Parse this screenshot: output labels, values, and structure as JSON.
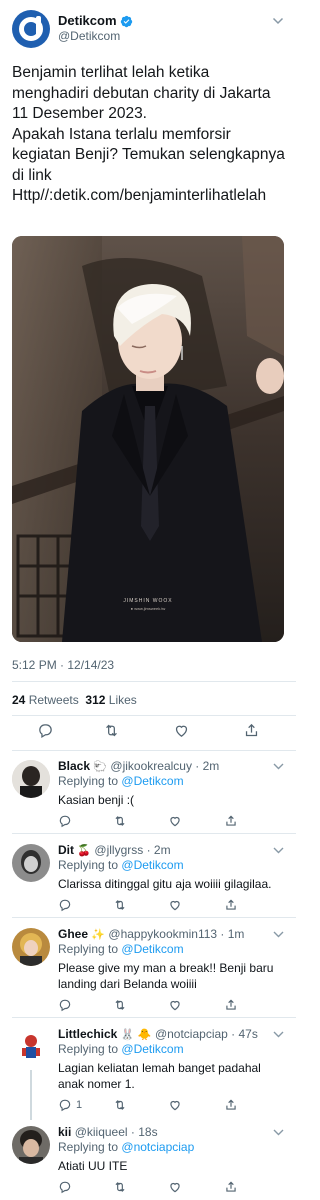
{
  "main": {
    "author_name": "Detikcom",
    "author_handle": "@Detikcom",
    "text": "Benjamin terlihat lelah ketika menghadiri debutan charity di Jakarta 11 Desember 2023.\nApakah Istana terlalu memforsir kegiatan Benji? Temukan selengkapnya di link Http//:detik.com/benjaminterlihatlelah",
    "photo_caption": "JIMSHIN WOOX",
    "photo_caption2": "● www.jimsweek.tw",
    "timestamp": "5:12 PM · 12/14/23",
    "retweets": "24",
    "retweets_label": "Retweets",
    "likes": "312",
    "likes_label": "Likes"
  },
  "replies": [
    {
      "name": "Black",
      "name_emoji": "🐑",
      "handle": "@jikookrealcuy · 2m",
      "replying_label": "Replying to",
      "replying_to": "@Detikcom",
      "text": "Kasian benji :(",
      "reply_count": ""
    },
    {
      "name": "Dit",
      "name_emoji": "🍒",
      "handle": "@jllygrss · 2m",
      "replying_label": "Replying to",
      "replying_to": "@Detikcom",
      "text": "Clarissa ditinggal gitu aja woiiii gilagilaa.",
      "reply_count": ""
    },
    {
      "name": "Ghee",
      "name_emoji": "✨",
      "handle": "@happykookmin113 · 1m",
      "replying_label": "Replying to",
      "replying_to": "@Detikcom",
      "text": "Please give my man a break!! Benji baru landing dari Belanda woiiii",
      "reply_count": ""
    },
    {
      "name": "Littlechick",
      "name_emoji": "🐰 🐥",
      "handle": "@notciapciap · 47s",
      "replying_label": "Replying to",
      "replying_to": "@Detikcom",
      "text": "Lagian keliatan lemah banget padahal anak nomer 1.",
      "reply_count": "1"
    },
    {
      "name": "kii",
      "name_emoji": "",
      "handle": "@kiiqueel · 18s",
      "replying_label": "Replying to",
      "replying_to": "@notciapciap",
      "text": "Atiati UU ITE",
      "reply_count": ""
    }
  ],
  "colors": {
    "brand_blue": "#1d9bf0",
    "detik_blue": "#1f5fb0",
    "muted": "#536471"
  },
  "icons": [
    "verified-badge-icon",
    "chevron-down-icon",
    "reply-icon",
    "retweet-icon",
    "like-icon",
    "share-icon"
  ]
}
